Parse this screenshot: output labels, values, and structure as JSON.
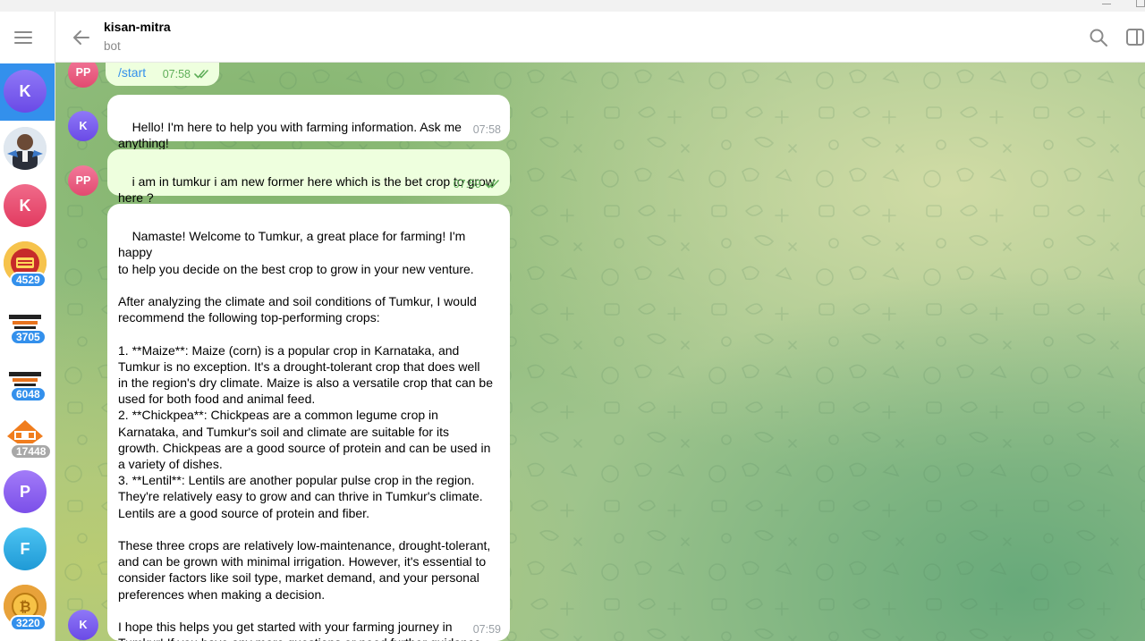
{
  "header": {
    "title": "kisan-mitra",
    "subtitle": "bot"
  },
  "sidebar": {
    "chats": [
      {
        "initial": "K",
        "color": "#7b5cf0",
        "badge": "",
        "active": true,
        "image": ""
      },
      {
        "initial": "",
        "color": "#c8d2dc",
        "badge": "",
        "active": false,
        "image": "person-photo"
      },
      {
        "initial": "K",
        "color": "#ec4b6e",
        "badge": "",
        "active": false,
        "image": ""
      },
      {
        "initial": "",
        "color": "#f3b23a",
        "badge": "4529",
        "active": false,
        "image": "festival-logo"
      },
      {
        "initial": "",
        "color": "#ffffff",
        "badge": "3705",
        "active": false,
        "image": "discount-deals-logo"
      },
      {
        "initial": "",
        "color": "#ffffff",
        "badge": "6048",
        "active": false,
        "image": "discount-deals-logo"
      },
      {
        "initial": "",
        "color": "#ffffff",
        "badge": "17448",
        "badge_muted": true,
        "active": false,
        "image": "dod-logo"
      },
      {
        "initial": "P",
        "color": "#8b5cf6",
        "badge": "",
        "active": false,
        "image": ""
      },
      {
        "initial": "F",
        "color": "#2eaee5",
        "badge": "",
        "active": false,
        "image": ""
      },
      {
        "initial": "",
        "color": "#f0a020",
        "badge": "3220",
        "active": false,
        "image": "bitcoin-logo"
      }
    ]
  },
  "messages": [
    {
      "from": "out",
      "avatar": "PP",
      "text": "/start",
      "time": "07:58"
    },
    {
      "from": "in",
      "avatar": "K",
      "text": "Hello! I'm here to help you with farming information. Ask me\nanything!",
      "time": "07:58"
    },
    {
      "from": "out",
      "avatar": "PP",
      "text": "i am in tumkur i am new former here which is the bet crop to grow\nhere ?",
      "time": "07:59"
    },
    {
      "from": "in",
      "avatar": "K",
      "text": "Namaste! Welcome to Tumkur, a great place for farming! I'm happy\nto help you decide on the best crop to grow in your new venture.\n\nAfter analyzing the climate and soil conditions of Tumkur, I would\nrecommend the following top-performing crops:\n\n1. **Maize**: Maize (corn) is a popular crop in Karnataka, and\nTumkur is no exception. It's a drought-tolerant crop that does well\nin the region's dry climate. Maize is also a versatile crop that can be\nused for both food and animal feed.\n2. **Chickpea**: Chickpeas are a common legume crop in\nKarnataka, and Tumkur's soil and climate are suitable for its\ngrowth. Chickpeas are a good source of protein and can be used in\na variety of dishes.\n3. **Lentil**: Lentils are another popular pulse crop in the region.\nThey're relatively easy to grow and can thrive in Tumkur's climate.\nLentils are a good source of protein and fiber.\n\nThese three crops are relatively low-maintenance, drought-tolerant,\nand can be grown with minimal irrigation. However, it's essential to\nconsider factors like soil type, market demand, and your personal\npreferences when making a decision.\n\nI hope this helps you get started with your farming journey in\nTumkur! If you have any more questions or need further guidance,\nplease feel free to ask.",
      "time": "07:59"
    }
  ],
  "colors": {
    "accent": "#3390ec",
    "out_bubble": "#eeffde",
    "in_bubble": "#ffffff",
    "pp_avatar": "#ec5e7e",
    "k_avatar": "#7b5cf0"
  }
}
